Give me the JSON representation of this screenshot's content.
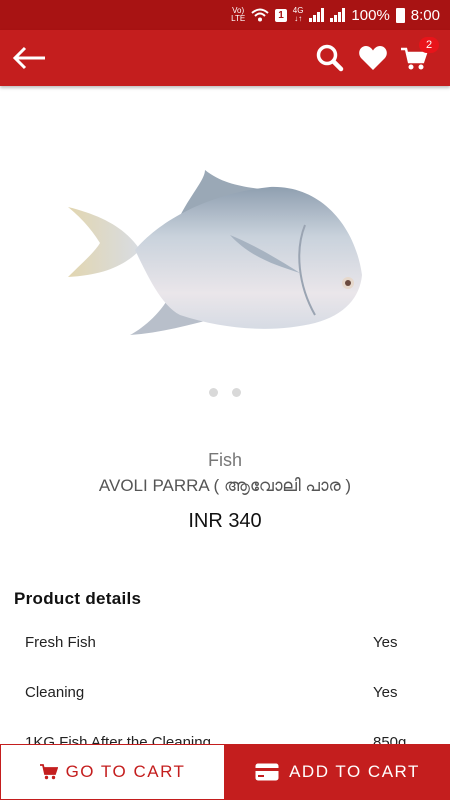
{
  "status_bar": {
    "volte_top": "Vo)",
    "volte_bottom": "LTE",
    "sim_badge": "1",
    "network_top": "4G",
    "network_bottom": "↓↑",
    "battery": "100%",
    "time": "8:00"
  },
  "app_bar": {
    "icons": [
      "back-arrow-icon",
      "search-icon",
      "heart-icon",
      "cart-icon"
    ],
    "cart_count": "2"
  },
  "product": {
    "category": "Fish",
    "name": "AVOLI PARRA ( ആവോലി പാര )",
    "price": "INR 340",
    "image_count": 2,
    "active_image": 1
  },
  "details": {
    "title": "Product details",
    "rows": [
      {
        "label": "Fresh Fish",
        "value": "Yes"
      },
      {
        "label": "Cleaning",
        "value": "Yes"
      },
      {
        "label": "1KG Fish After the Cleaning",
        "value": "850g"
      }
    ]
  },
  "actions": {
    "go_to_cart": "GO TO CART",
    "add_to_cart": "ADD TO CART"
  },
  "colors": {
    "primary": "#c41e1e",
    "status_bar": "#a81313",
    "badge": "#e8141a"
  }
}
